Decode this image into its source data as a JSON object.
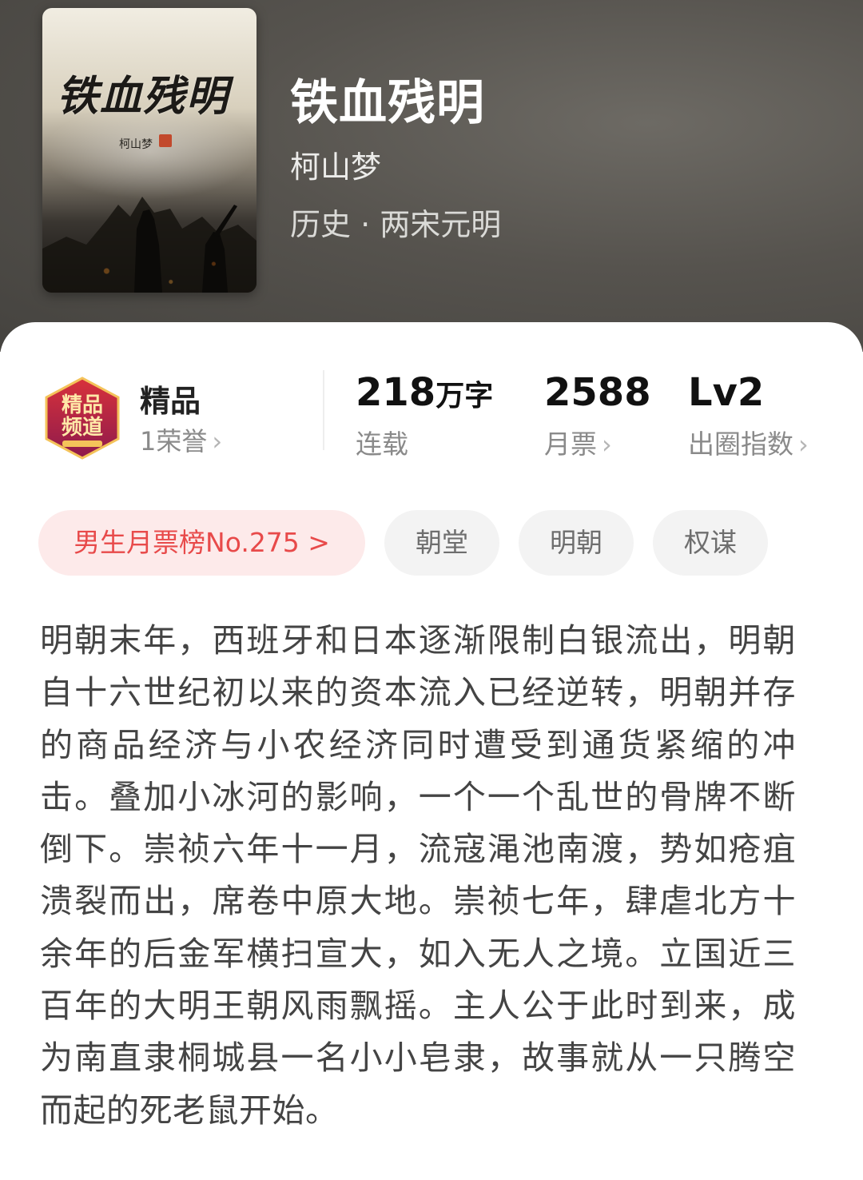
{
  "book": {
    "cover_title": "铁血残明",
    "cover_author": "柯山梦",
    "title": "铁血残明",
    "author": "柯山梦",
    "genre": "历史 · 两宋元明"
  },
  "honor": {
    "badge_icon": "jingpin-pindao-badge-icon",
    "badge_text_line1": "精品",
    "badge_text_line2": "频道",
    "title": "精品",
    "subtitle": "1荣誉"
  },
  "stats": {
    "words_value": "218",
    "words_unit": "万字",
    "words_label": "连载",
    "tickets_value": "2588",
    "tickets_label": "月票",
    "level_value": "Lv2",
    "level_label": "出圈指数"
  },
  "tags": {
    "rank": "男生月票榜No.275 >",
    "items": [
      "朝堂",
      "明朝",
      "权谋"
    ]
  },
  "colors": {
    "accent_red": "#e84a4a",
    "rank_bg": "#fdeaea",
    "tag_bg": "#f3f3f3"
  },
  "synopsis": "明朝末年，西班牙和日本逐渐限制白银流出，明朝自十六世纪初以来的资本流入已经逆转，明朝并存的商品经济与小农经济同时遭受到通货紧缩的冲击。叠加小冰河的影响，一个一个乱世的骨牌不断倒下。崇祯六年十一月，流寇渑池南渡，势如疮疽溃裂而出，席卷中原大地。崇祯七年，肆虐北方十余年的后金军横扫宣大，如入无人之境。立国近三百年的大明王朝风雨飘摇。主人公于此时到来，成为南直隶桐城县一名小小皂隶，故事就从一只腾空而起的死老鼠开始。"
}
